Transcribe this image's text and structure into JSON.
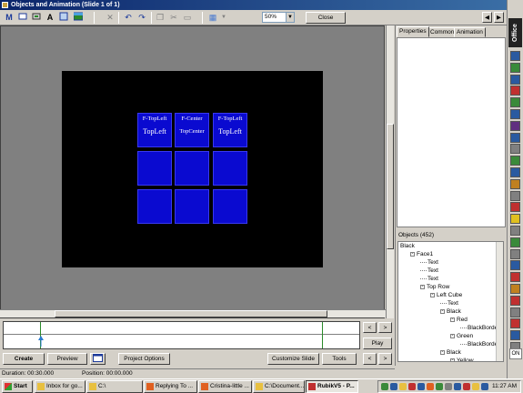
{
  "window": {
    "title": "Objects and Animation  (Slide 1 of 1)"
  },
  "toolbar": {
    "zoom_value": "50%",
    "close_label": "Close",
    "icons": [
      "text-m-icon",
      "rectangle-icon",
      "image-icon",
      "text-a-icon",
      "shape-icon",
      "picture-icon",
      "delete-icon",
      "undo-icon",
      "redo-icon",
      "copy-icon",
      "cut-icon",
      "paste-icon",
      "grid-icon"
    ]
  },
  "slide": {
    "background": "#000000",
    "tile_color": "#0a0ad0",
    "tiles": [
      {
        "line1": "F-TopLeft",
        "line2": "TopLeft"
      },
      {
        "line1": "F-Center",
        "line2": "TopCenter"
      },
      {
        "line1": "F-TopLeft",
        "line2": "TopLeft"
      },
      {
        "line1": "",
        "line2": ""
      },
      {
        "line1": "",
        "line2": ""
      },
      {
        "line1": "",
        "line2": ""
      },
      {
        "line1": "",
        "line2": ""
      },
      {
        "line1": "",
        "line2": ""
      },
      {
        "line1": "",
        "line2": ""
      }
    ]
  },
  "properties": {
    "tabs": [
      {
        "label": "Properties"
      },
      {
        "label": "Common"
      },
      {
        "label": "Animation"
      }
    ]
  },
  "objects": {
    "title": "Objects (452)",
    "tree": [
      {
        "label": "Black",
        "depth": 0,
        "toggle": ""
      },
      {
        "label": "Face1",
        "depth": 1,
        "toggle": "-"
      },
      {
        "label": "Text",
        "depth": 2,
        "toggle": ""
      },
      {
        "label": "Text",
        "depth": 2,
        "toggle": ""
      },
      {
        "label": "Text",
        "depth": 2,
        "toggle": ""
      },
      {
        "label": "Top Row",
        "depth": 2,
        "toggle": "-"
      },
      {
        "label": "Left Cube",
        "depth": 3,
        "toggle": "-"
      },
      {
        "label": "Text",
        "depth": 4,
        "toggle": ""
      },
      {
        "label": "Black",
        "depth": 4,
        "toggle": "-"
      },
      {
        "label": "Red",
        "depth": 5,
        "toggle": "-"
      },
      {
        "label": "BlackBorder",
        "depth": 6,
        "toggle": ""
      },
      {
        "label": "Green",
        "depth": 5,
        "toggle": "-"
      },
      {
        "label": "BlackBorder",
        "depth": 6,
        "toggle": ""
      },
      {
        "label": "Black",
        "depth": 4,
        "toggle": "-"
      },
      {
        "label": "Yellow",
        "depth": 5,
        "toggle": "-"
      }
    ]
  },
  "timeline": {
    "play_label": "Play",
    "marker_fraction": 0.105
  },
  "bottom_buttons": {
    "create": "Create",
    "preview": "Preview",
    "project_options": "Project Options",
    "customize_slide": "Customize Slide",
    "tools": "Tools"
  },
  "status": {
    "duration": "Duration:  00:30.000",
    "position": "Position:  00:00.000"
  },
  "officebar": {
    "logo": "Office",
    "bottom_label": "ON"
  },
  "taskbar": {
    "start": "Start",
    "tasks": [
      {
        "label": "Inbox for go...",
        "pressed": false
      },
      {
        "label": "C:\\",
        "pressed": false
      },
      {
        "label": "Replying To ...",
        "pressed": false
      },
      {
        "label": "Cristina-little ...",
        "pressed": false
      },
      {
        "label": "C:\\Document...",
        "pressed": false
      },
      {
        "label": "RubikV5 - P...",
        "pressed": true
      }
    ],
    "clock": "11:27 AM"
  }
}
